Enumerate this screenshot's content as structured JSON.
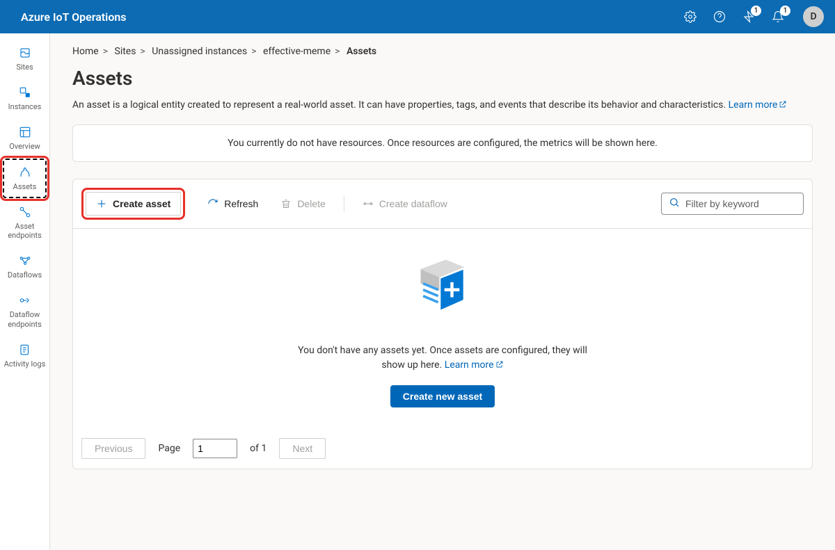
{
  "header": {
    "title": "Azure IoT Operations",
    "badge1": "1",
    "badge2": "1",
    "avatar": "D"
  },
  "sidebar": {
    "items": [
      {
        "label": "Sites"
      },
      {
        "label": "Instances"
      },
      {
        "label": "Overview"
      },
      {
        "label": "Assets"
      },
      {
        "label": "Asset endpoints"
      },
      {
        "label": "Dataflows"
      },
      {
        "label": "Dataflow endpoints"
      },
      {
        "label": "Activity logs"
      }
    ]
  },
  "breadcrumb": {
    "items": [
      "Home",
      "Sites",
      "Unassigned instances",
      "effective-meme",
      "Assets"
    ]
  },
  "page": {
    "title": "Assets",
    "description": "An asset is a logical entity created to represent a real-world asset. It can have properties, tags, and events that describe its behavior and characteristics. ",
    "learn_more": "Learn more",
    "info": "You currently do not have resources. Once resources are configured, the metrics will be shown here."
  },
  "toolbar": {
    "create": "Create asset",
    "refresh": "Refresh",
    "delete": "Delete",
    "dataflow": "Create dataflow",
    "filter_placeholder": "Filter by keyword"
  },
  "empty": {
    "text1": "You don't have any assets yet. Once assets are configured, they will show up here. ",
    "learn_more": "Learn more",
    "button": "Create new asset"
  },
  "pager": {
    "prev": "Previous",
    "page_label": "Page",
    "current": "1",
    "of_label": "of 1",
    "next": "Next"
  }
}
